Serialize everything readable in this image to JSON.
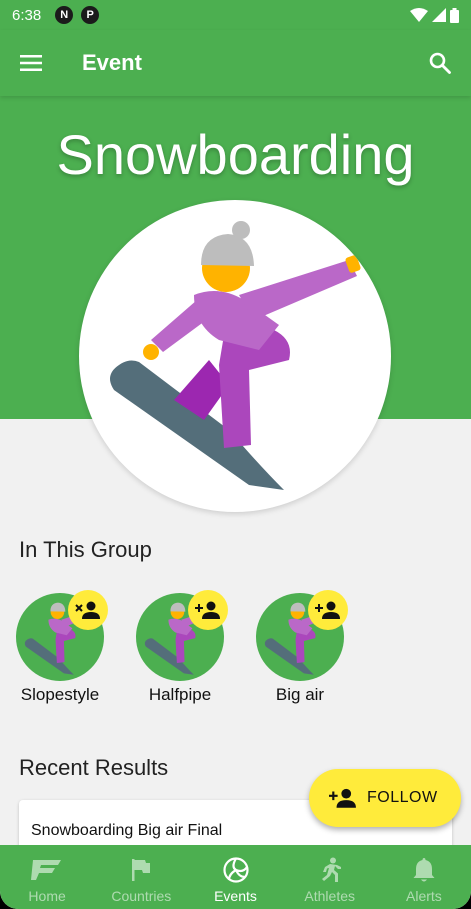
{
  "status": {
    "time": "6:38",
    "icon1": "N",
    "icon2": "P"
  },
  "app_bar": {
    "title": "Event",
    "menu_icon": "hamburger-menu-icon",
    "search_icon": "search-icon"
  },
  "hero": {
    "title": "Snowboarding"
  },
  "group": {
    "title": "In This Group",
    "items": [
      {
        "label": "Slopestyle",
        "badge": "person-remove-icon"
      },
      {
        "label": "Halfpipe",
        "badge": "person-add-icon"
      },
      {
        "label": "Big air",
        "badge": "person-add-icon"
      }
    ]
  },
  "results": {
    "title": "Recent Results",
    "items": [
      {
        "label": "Snowboarding Big air Final"
      }
    ]
  },
  "fab": {
    "label": "FOLLOW"
  },
  "bottom_nav": [
    {
      "label": "Home",
      "icon": "flag-f-logo-icon"
    },
    {
      "label": "Countries",
      "icon": "flag-icon"
    },
    {
      "label": "Events",
      "icon": "volleyball-icon"
    },
    {
      "label": "Athletes",
      "icon": "runner-icon"
    },
    {
      "label": "Alerts",
      "icon": "bell-icon"
    }
  ],
  "colors": {
    "primary": "#4caf50",
    "accent": "#ffeb3b",
    "background": "#f1f1f1"
  }
}
